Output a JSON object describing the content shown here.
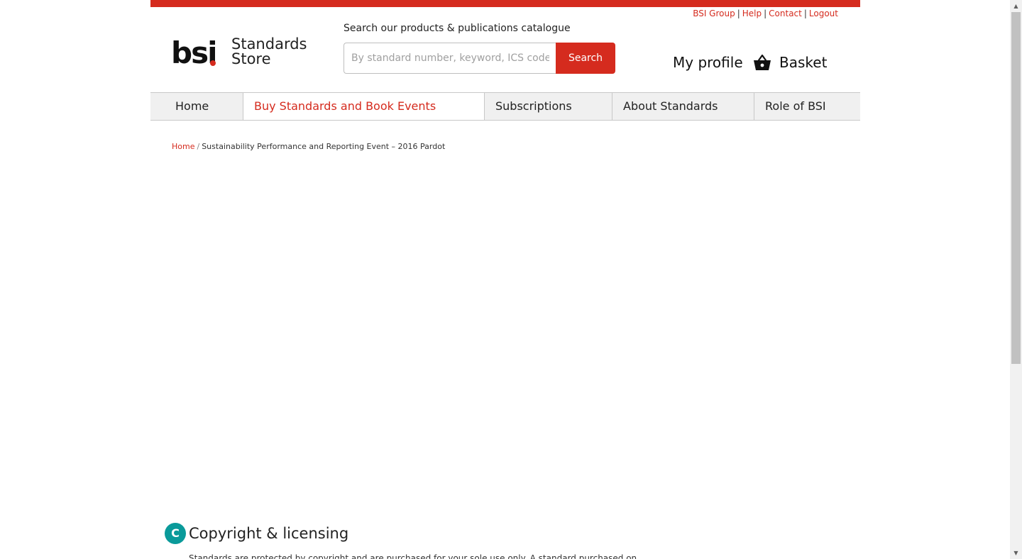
{
  "header": {
    "utility_links": [
      "BSI Group",
      "Help",
      "Contact",
      "Logout"
    ],
    "separator": "|",
    "logo": {
      "mark": "bsi",
      "line1": "Standards",
      "line2": "Store"
    },
    "search": {
      "label": "Search our products & publications catalogue",
      "placeholder": "By standard number, keyword, ICS code, ISBN",
      "button_label": "Search"
    },
    "my_profile_label": "My profile",
    "basket": {
      "icon": "basket-icon",
      "label": "Basket"
    }
  },
  "nav": {
    "items": [
      {
        "label": "Home",
        "active": false
      },
      {
        "label": "Buy Standards and Book Events",
        "active": true
      },
      {
        "label": "Subscriptions",
        "active": false
      },
      {
        "label": "About Standards",
        "active": false
      },
      {
        "label": "Role of BSI",
        "active": false
      }
    ]
  },
  "breadcrumb": {
    "home": "Home",
    "separator": "/",
    "current": "Sustainability Performance and Reporting Event – 2016 Pardot"
  },
  "copyright": {
    "badge": "C",
    "title": "Copyright & licensing",
    "text": "Standards are protected by copyright and are purchased for your sole use only. A standard purchased on"
  },
  "colors": {
    "brand_red": "#d52b1e",
    "teal": "#0a9a9a",
    "nav_bg": "#f0f0f0"
  }
}
